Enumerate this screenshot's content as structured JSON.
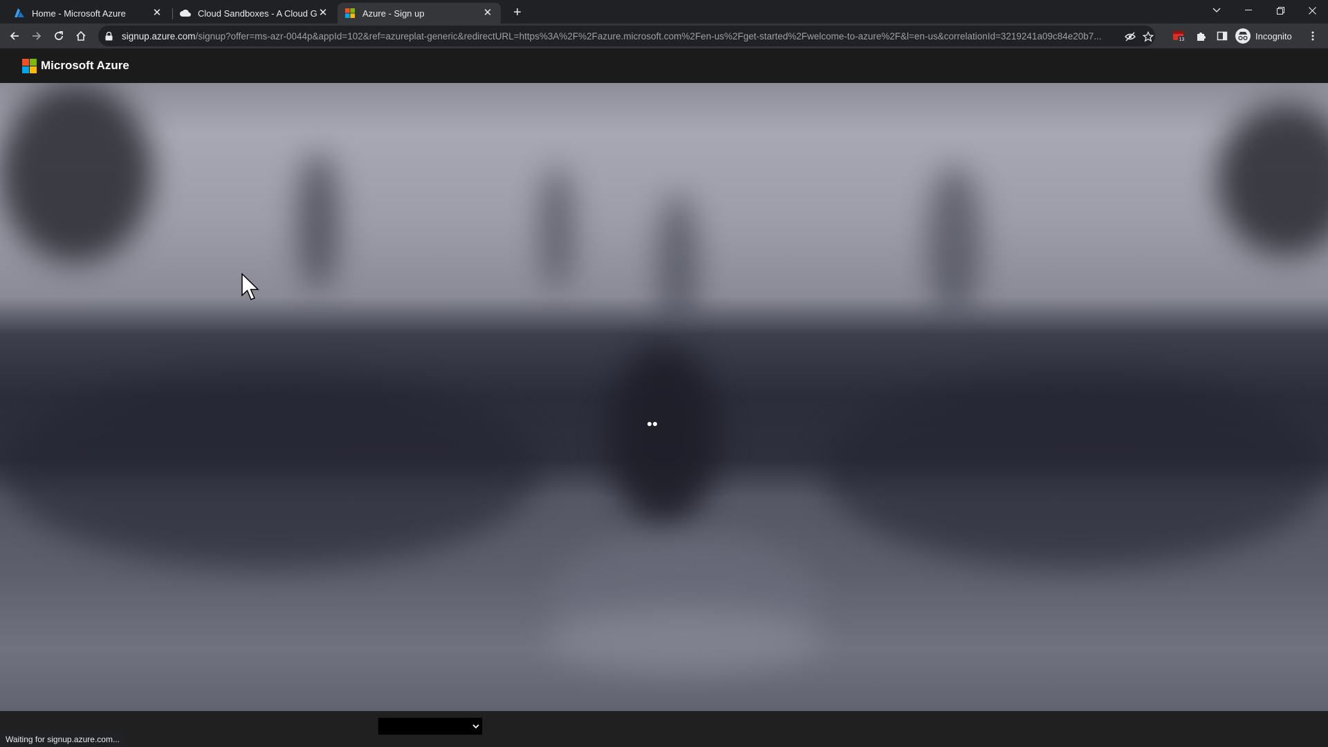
{
  "browser": {
    "tabs": [
      {
        "title": "Home - Microsoft Azure",
        "icon": "azure-icon",
        "active": false
      },
      {
        "title": "Cloud Sandboxes - A Cloud Guru",
        "icon": "cloud-icon",
        "active": false
      },
      {
        "title": "Azure - Sign up",
        "icon": "microsoft-icon",
        "active": true
      }
    ],
    "url_host": "signup.azure.com",
    "url_path": "/signup?offer=ms-azr-0044p&appId=102&ref=azureplat-generic&redirectURL=https%3A%2F%2Fazure.microsoft.com%2Fen-us%2Fget-started%2Fwelcome-to-azure%2F&l=en-us&correlationId=3219241a09c84e20b7...",
    "profile_label": "Incognito",
    "extension_badge": "13",
    "status_text": "Waiting for signup.azure.com..."
  },
  "page": {
    "brand": "Microsoft Azure",
    "language_select_value": ""
  },
  "colors": {
    "ms_red": "#f25022",
    "ms_green": "#7fba00",
    "ms_blue": "#00a4ef",
    "ms_yellow": "#ffb900",
    "azure_blue": "#0078d4"
  }
}
